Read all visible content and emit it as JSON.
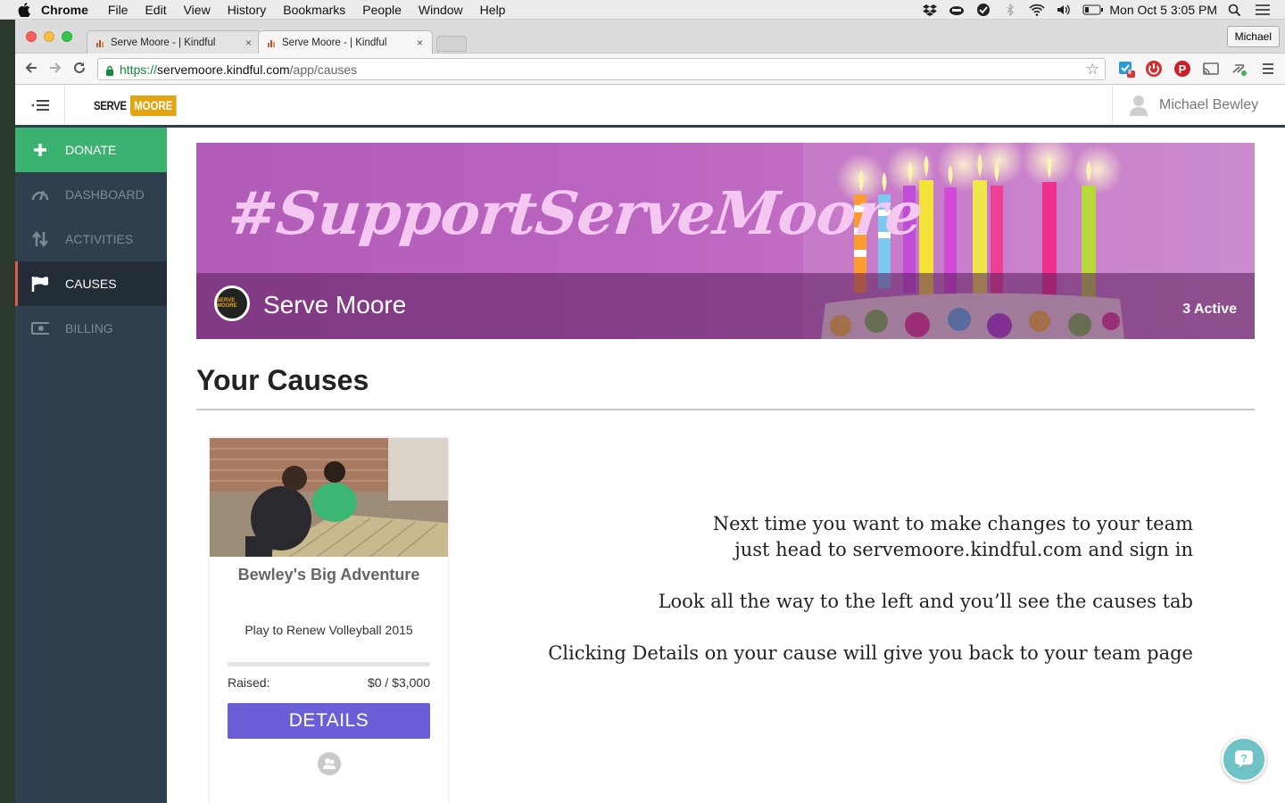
{
  "menubar": {
    "app": "Chrome",
    "items": [
      "File",
      "Edit",
      "View",
      "History",
      "Bookmarks",
      "People",
      "Window",
      "Help"
    ],
    "clock": "Mon Oct 5  3:05 PM"
  },
  "browser": {
    "tabs": [
      {
        "title": "Serve Moore - | Kindful",
        "close": "×"
      },
      {
        "title": "Serve Moore - | Kindful",
        "close": "×"
      }
    ],
    "profile": "Michael",
    "url": {
      "scheme": "https://",
      "host": "servemoore.kindful.com",
      "path": "/app/causes"
    },
    "extension_badge": "8"
  },
  "header": {
    "logo_serve": "SERVE",
    "logo_moore": "MOORE",
    "user_name": "Michael Bewley"
  },
  "sidebar": {
    "items": [
      {
        "label": "DONATE",
        "icon": "plus-icon"
      },
      {
        "label": "DASHBOARD",
        "icon": "gauge-icon"
      },
      {
        "label": "ACTIVITIES",
        "icon": "arrows-updown-icon"
      },
      {
        "label": "CAUSES",
        "icon": "flag-icon"
      },
      {
        "label": "BILLING",
        "icon": "money-icon"
      }
    ],
    "active": "CAUSES"
  },
  "banner": {
    "hashtag": "#SupportServeMoore",
    "org_name": "Serve Moore",
    "org_logo_text": "SERVE MOORE",
    "active_count": "3 Active"
  },
  "section": {
    "title": "Your Causes"
  },
  "card": {
    "title": "Bewley's Big Adventure",
    "campaign": "Play to Renew Volleyball 2015",
    "raised_label": "Raised:",
    "raised_value": "$0 / $3,000",
    "progress_fraction": 0,
    "button": "DETAILS"
  },
  "instructions": {
    "line1": "Next time you want to make changes to your team",
    "line2": "just head to servemoore.kindful.com and sign in",
    "line3": "Look all the way to the left and you’ll see the causes tab",
    "line4": "Clicking Details on your cause will give you back to your team page"
  },
  "colors": {
    "sidebar_bg": "#2f3f4e",
    "donate_green": "#3bb26f",
    "active_accent": "#e35a4a",
    "button_purple": "#6a5fd6",
    "brand_gold": "#e3a413",
    "help_teal": "#6fc3c6"
  }
}
